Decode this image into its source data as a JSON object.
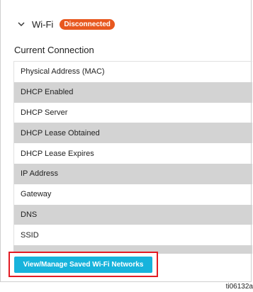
{
  "wifi": {
    "label": "Wi-Fi",
    "status_badge": "Disconnected",
    "badge_color": "#e8581f"
  },
  "current_connection": {
    "title": "Current Connection",
    "rows": [
      "Physical Address (MAC)",
      "DHCP Enabled",
      "DHCP Server",
      "DHCP Lease Obtained",
      "DHCP Lease Expires",
      "IP Address",
      "Gateway",
      "DNS",
      "SSID"
    ]
  },
  "actions": {
    "manage_networks_label": "View/Manage Saved Wi-Fi Networks",
    "button_color": "#17b3dc",
    "highlight_color": "#e21b23"
  },
  "figure_id": "ti06132a"
}
